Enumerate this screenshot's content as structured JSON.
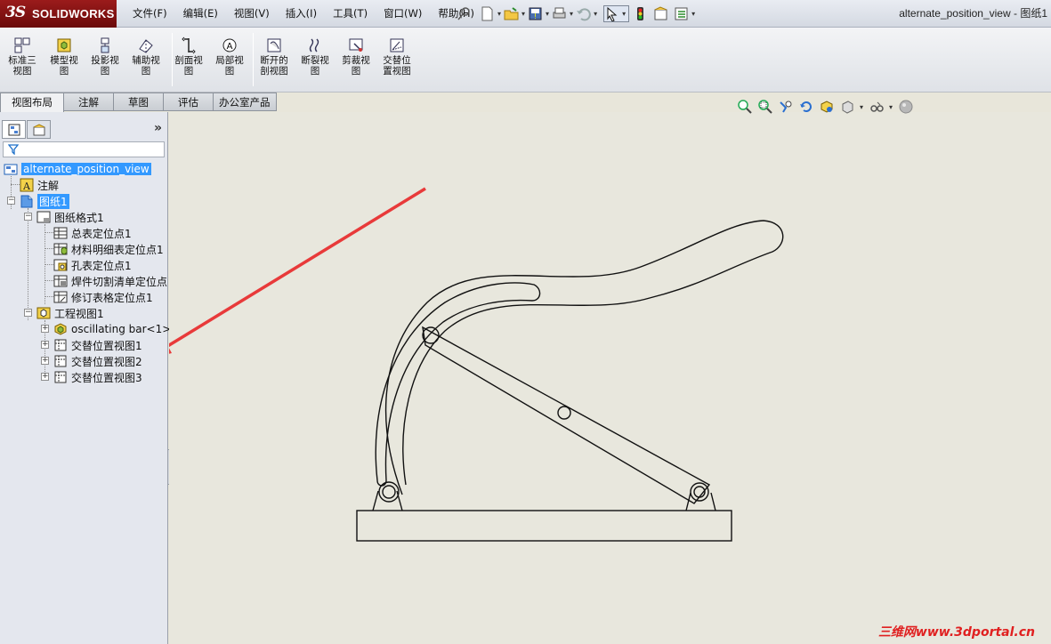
{
  "app": {
    "logo_ds": "3S",
    "logo_text": "SOLIDWORKS",
    "doc_title": "alternate_position_view - 图纸1"
  },
  "menu": [
    "文件(F)",
    "编辑(E)",
    "视图(V)",
    "插入(I)",
    "工具(T)",
    "窗口(W)",
    "帮助(H)"
  ],
  "commands": [
    {
      "label": "标准三\n视图",
      "icon": "standard-3-view-icon"
    },
    {
      "label": "模型视\n图",
      "icon": "model-view-icon"
    },
    {
      "label": "投影视\n图",
      "icon": "projected-view-icon"
    },
    {
      "label": "辅助视\n图",
      "icon": "auxiliary-view-icon"
    },
    {
      "label": "剖面视\n图",
      "icon": "section-view-icon"
    },
    {
      "label": "局部视\n图",
      "icon": "detail-view-icon"
    },
    {
      "label": "断开的\n剖视图",
      "icon": "broken-out-section-icon"
    },
    {
      "label": "断裂视\n图",
      "icon": "break-view-icon"
    },
    {
      "label": "剪裁视\n图",
      "icon": "crop-view-icon"
    },
    {
      "label": "交替位\n置视图",
      "icon": "alternate-position-view-icon"
    }
  ],
  "tabs": [
    "视图布局",
    "注解",
    "草图",
    "评估",
    "办公室产品"
  ],
  "active_tab": "视图布局",
  "panel": {
    "expand_glyph": "»",
    "tree": {
      "root": "alternate_position_view",
      "annotations": "注解",
      "sheet": "图纸1",
      "sheet_format": "图纸格式1",
      "anchors": [
        "总表定位点1",
        "材料明细表定位点1",
        "孔表定位点1",
        "焊件切割清单定位点",
        "修订表格定位点1"
      ],
      "drawing_view": "工程视图1",
      "part": "oscillating bar<1>",
      "alternate_views": [
        "交替位置视图1",
        "交替位置视图2",
        "交替位置视图3"
      ]
    }
  },
  "watermark": "三维网www.3dportal.cn",
  "colors": {
    "selection": "#3399ff",
    "canvas": "#e8e7dd",
    "arrow": "#e83a3a",
    "logo": "#8a1414"
  }
}
